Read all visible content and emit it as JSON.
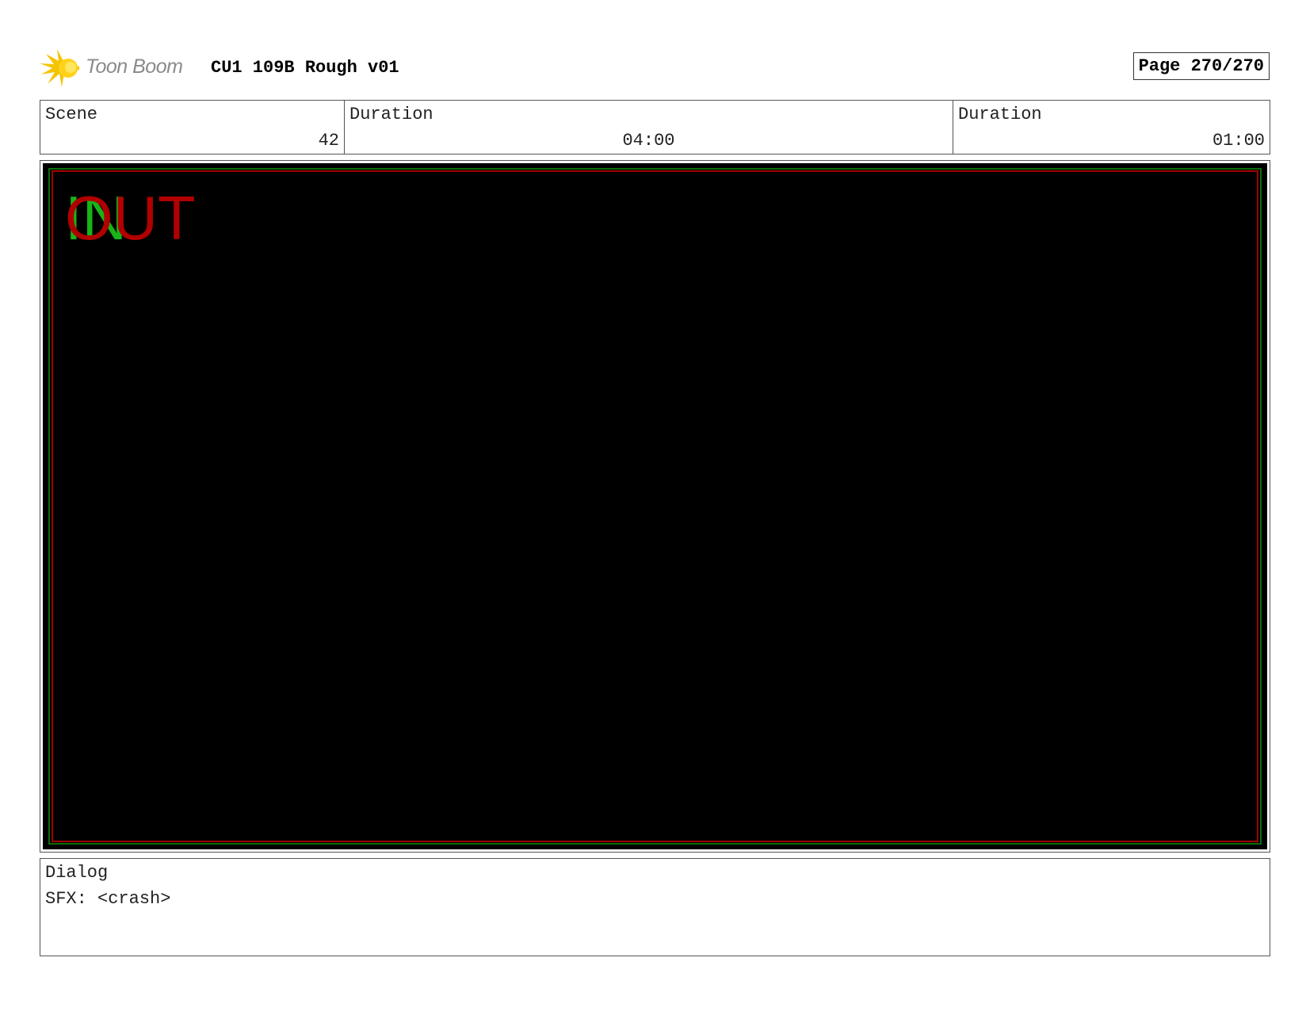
{
  "header": {
    "logo_text": "Toon Boom",
    "title": "CU1 109B Rough v01",
    "page_label": "Page 270/270"
  },
  "info": {
    "scene_label": "Scene",
    "scene_value": "42",
    "duration1_label": "Duration",
    "duration1_value": "04:00",
    "duration2_label": "Duration",
    "duration2_value": "01:00"
  },
  "panel": {
    "in_mark": "IN",
    "out_mark": "OUT",
    "colors": {
      "background": "#000000",
      "in_color": "#18b418",
      "out_color": "#b00000"
    }
  },
  "dialog": {
    "label": "Dialog",
    "text": "SFX: <crash>"
  },
  "icons": {
    "logo": "starburst-logo-icon"
  }
}
